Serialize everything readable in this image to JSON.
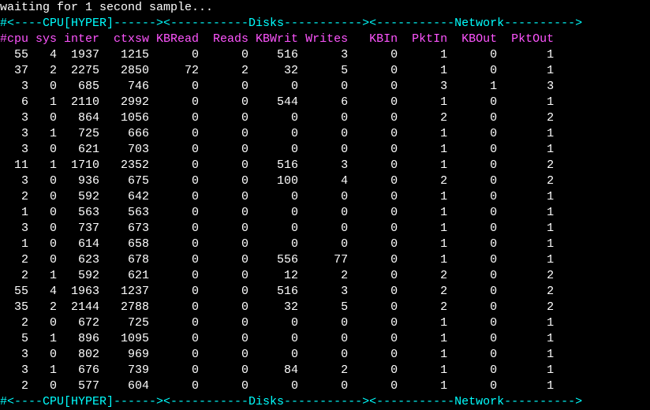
{
  "wait_line": "waiting for 1 second sample...",
  "section_rule_1": "#<----CPU[HYPER]------><-----------Disks-----------><-----------Network---------->",
  "section_rule_2": "#<----CPU[HYPER]------><-----------Disks-----------><-----------Network---------->",
  "col_labels_line": "#cpu sys inter  ctxsw KBRead  Reads KBWrit Writes   KBIn  PktIn  KBOut  PktOut",
  "columns": [
    "cpu",
    "sys",
    "inter",
    "ctxsw",
    "KBRead",
    "Reads",
    "KBWrit",
    "Writes",
    "KBIn",
    "PktIn",
    "KBOut",
    "PktOut"
  ],
  "rows": [
    {
      "cpu": 55,
      "sys": 4,
      "inter": 1937,
      "ctxsw": 1215,
      "KBRead": 0,
      "Reads": 0,
      "KBWrit": 516,
      "Writes": 3,
      "KBIn": 0,
      "PktIn": 1,
      "KBOut": 0,
      "PktOut": 1
    },
    {
      "cpu": 37,
      "sys": 2,
      "inter": 2275,
      "ctxsw": 2850,
      "KBRead": 72,
      "Reads": 2,
      "KBWrit": 32,
      "Writes": 5,
      "KBIn": 0,
      "PktIn": 1,
      "KBOut": 0,
      "PktOut": 1
    },
    {
      "cpu": 3,
      "sys": 0,
      "inter": 685,
      "ctxsw": 746,
      "KBRead": 0,
      "Reads": 0,
      "KBWrit": 0,
      "Writes": 0,
      "KBIn": 0,
      "PktIn": 3,
      "KBOut": 1,
      "PktOut": 3
    },
    {
      "cpu": 6,
      "sys": 1,
      "inter": 2110,
      "ctxsw": 2992,
      "KBRead": 0,
      "Reads": 0,
      "KBWrit": 544,
      "Writes": 6,
      "KBIn": 0,
      "PktIn": 1,
      "KBOut": 0,
      "PktOut": 1
    },
    {
      "cpu": 3,
      "sys": 0,
      "inter": 864,
      "ctxsw": 1056,
      "KBRead": 0,
      "Reads": 0,
      "KBWrit": 0,
      "Writes": 0,
      "KBIn": 0,
      "PktIn": 2,
      "KBOut": 0,
      "PktOut": 2
    },
    {
      "cpu": 3,
      "sys": 1,
      "inter": 725,
      "ctxsw": 666,
      "KBRead": 0,
      "Reads": 0,
      "KBWrit": 0,
      "Writes": 0,
      "KBIn": 0,
      "PktIn": 1,
      "KBOut": 0,
      "PktOut": 1
    },
    {
      "cpu": 3,
      "sys": 0,
      "inter": 621,
      "ctxsw": 703,
      "KBRead": 0,
      "Reads": 0,
      "KBWrit": 0,
      "Writes": 0,
      "KBIn": 0,
      "PktIn": 1,
      "KBOut": 0,
      "PktOut": 1
    },
    {
      "cpu": 11,
      "sys": 1,
      "inter": 1710,
      "ctxsw": 2352,
      "KBRead": 0,
      "Reads": 0,
      "KBWrit": 516,
      "Writes": 3,
      "KBIn": 0,
      "PktIn": 1,
      "KBOut": 0,
      "PktOut": 2
    },
    {
      "cpu": 3,
      "sys": 0,
      "inter": 936,
      "ctxsw": 675,
      "KBRead": 0,
      "Reads": 0,
      "KBWrit": 100,
      "Writes": 4,
      "KBIn": 0,
      "PktIn": 2,
      "KBOut": 0,
      "PktOut": 2
    },
    {
      "cpu": 2,
      "sys": 0,
      "inter": 592,
      "ctxsw": 642,
      "KBRead": 0,
      "Reads": 0,
      "KBWrit": 0,
      "Writes": 0,
      "KBIn": 0,
      "PktIn": 1,
      "KBOut": 0,
      "PktOut": 1
    },
    {
      "cpu": 1,
      "sys": 0,
      "inter": 563,
      "ctxsw": 563,
      "KBRead": 0,
      "Reads": 0,
      "KBWrit": 0,
      "Writes": 0,
      "KBIn": 0,
      "PktIn": 1,
      "KBOut": 0,
      "PktOut": 1
    },
    {
      "cpu": 3,
      "sys": 0,
      "inter": 737,
      "ctxsw": 673,
      "KBRead": 0,
      "Reads": 0,
      "KBWrit": 0,
      "Writes": 0,
      "KBIn": 0,
      "PktIn": 1,
      "KBOut": 0,
      "PktOut": 1
    },
    {
      "cpu": 1,
      "sys": 0,
      "inter": 614,
      "ctxsw": 658,
      "KBRead": 0,
      "Reads": 0,
      "KBWrit": 0,
      "Writes": 0,
      "KBIn": 0,
      "PktIn": 1,
      "KBOut": 0,
      "PktOut": 1
    },
    {
      "cpu": 2,
      "sys": 0,
      "inter": 623,
      "ctxsw": 678,
      "KBRead": 0,
      "Reads": 0,
      "KBWrit": 556,
      "Writes": 77,
      "KBIn": 0,
      "PktIn": 1,
      "KBOut": 0,
      "PktOut": 1
    },
    {
      "cpu": 2,
      "sys": 1,
      "inter": 592,
      "ctxsw": 621,
      "KBRead": 0,
      "Reads": 0,
      "KBWrit": 12,
      "Writes": 2,
      "KBIn": 0,
      "PktIn": 2,
      "KBOut": 0,
      "PktOut": 2
    },
    {
      "cpu": 55,
      "sys": 4,
      "inter": 1963,
      "ctxsw": 1237,
      "KBRead": 0,
      "Reads": 0,
      "KBWrit": 516,
      "Writes": 3,
      "KBIn": 0,
      "PktIn": 2,
      "KBOut": 0,
      "PktOut": 2
    },
    {
      "cpu": 35,
      "sys": 2,
      "inter": 2144,
      "ctxsw": 2788,
      "KBRead": 0,
      "Reads": 0,
      "KBWrit": 32,
      "Writes": 5,
      "KBIn": 0,
      "PktIn": 2,
      "KBOut": 0,
      "PktOut": 2
    },
    {
      "cpu": 2,
      "sys": 0,
      "inter": 672,
      "ctxsw": 725,
      "KBRead": 0,
      "Reads": 0,
      "KBWrit": 0,
      "Writes": 0,
      "KBIn": 0,
      "PktIn": 1,
      "KBOut": 0,
      "PktOut": 1
    },
    {
      "cpu": 5,
      "sys": 1,
      "inter": 896,
      "ctxsw": 1095,
      "KBRead": 0,
      "Reads": 0,
      "KBWrit": 0,
      "Writes": 0,
      "KBIn": 0,
      "PktIn": 1,
      "KBOut": 0,
      "PktOut": 1
    },
    {
      "cpu": 3,
      "sys": 0,
      "inter": 802,
      "ctxsw": 969,
      "KBRead": 0,
      "Reads": 0,
      "KBWrit": 0,
      "Writes": 0,
      "KBIn": 0,
      "PktIn": 1,
      "KBOut": 0,
      "PktOut": 1
    },
    {
      "cpu": 3,
      "sys": 1,
      "inter": 676,
      "ctxsw": 739,
      "KBRead": 0,
      "Reads": 0,
      "KBWrit": 84,
      "Writes": 2,
      "KBIn": 0,
      "PktIn": 1,
      "KBOut": 0,
      "PktOut": 1
    },
    {
      "cpu": 2,
      "sys": 0,
      "inter": 577,
      "ctxsw": 604,
      "KBRead": 0,
      "Reads": 0,
      "KBWrit": 0,
      "Writes": 0,
      "KBIn": 0,
      "PktIn": 1,
      "KBOut": 0,
      "PktOut": 1
    }
  ]
}
